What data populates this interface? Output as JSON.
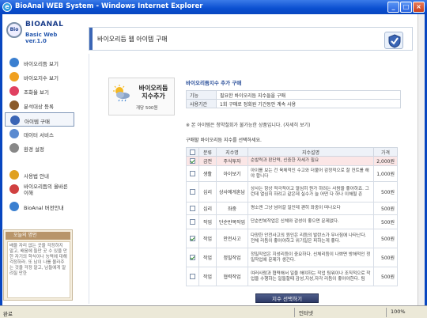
{
  "window": {
    "title": "BioAnal WEB System - Windows Internet Explorer"
  },
  "logo": {
    "line1": "BIOANAL",
    "line2": "Basic Web ver.1.0",
    "badge": "Bio"
  },
  "header": {
    "title": "바이오리듬 웹 아이템 구매"
  },
  "sidebar": {
    "items": [
      {
        "label": "바이오리듬 보기",
        "icon": "globe-icon",
        "color": "#3a7fd0"
      },
      {
        "label": "바이오지수 보기",
        "icon": "star-icon",
        "color": "#f0a020"
      },
      {
        "label": "조화율 보기",
        "icon": "heart-icon",
        "color": "#e04060"
      },
      {
        "label": "분석대상 등록",
        "icon": "pencil-icon",
        "color": "#8a5a2a"
      },
      {
        "label": "아이템 구매",
        "icon": "shield-icon",
        "color": "#3a65b5"
      },
      {
        "label": "데이터 서비스",
        "icon": "data-icon",
        "color": "#5a8ad0"
      },
      {
        "label": "환경 설정",
        "icon": "gear-icon",
        "color": "#888888"
      },
      {
        "label": "사용법 안내",
        "icon": "help-icon",
        "color": "#e0a020"
      },
      {
        "label": "바이오리듬의 올바른 이해",
        "icon": "info-icon",
        "color": "#d04040"
      },
      {
        "label": "BioAnal 버전안내",
        "icon": "monitor-icon",
        "color": "#3a7fd0"
      }
    ],
    "news_title": "오늘의 명언",
    "news_text": "배울 자리 없는 곳을 걱정하지 말고, 배움에 들만 곳 수 있을 만한 자기의 학식이나 능력에 대해 걱정하라. 또 남이 나를 몰라주는 것을 걱정 말고, 남들에게 알려질 만한"
  },
  "item_card": {
    "title_line1": "바이오리듬",
    "title_line2": "지수추가",
    "price": "개당 500원"
  },
  "section_title": "바이오리듬지수 추가 구매",
  "info": [
    {
      "key": "기능",
      "value": "필요한 바이오리듬 지수들을 구매"
    },
    {
      "key": "사용기간",
      "value": "1회 구매로 정회원 기간동안 계속 사용"
    }
  ],
  "notice": "※ 본 아이템은 청약철회가 불가능한 상품입니다. (자세히 보기)",
  "intro": "구매할 바이오리듬 지수를 선택하세요.",
  "table": {
    "headers": [
      "",
      "분류",
      "지수명",
      "지수설명",
      "가격"
    ],
    "rows": [
      {
        "checked": true,
        "cat": "금전",
        "name": "주식투자",
        "desc": "순발력과 판단력, 신중한 자세가 필요",
        "price": "2,000원",
        "highlight": true
      },
      {
        "checked": false,
        "cat": "생활",
        "name": "아이보기",
        "desc": "아이를 보는 건 육체적인 수고와 더불어 감정적으로 잘 컨트롤 해야 합니다",
        "price": "1,000원",
        "highlight": false
      },
      {
        "checked": false,
        "cat": "심리",
        "name": "상사에게혼남",
        "desc": "상사는 항상 적극적이고 열심히 뭔가 하려는 사람을 좋아하죠. 그런데 열심히 하려고 같은데 실수가 늘 어떤 다 하나 이해될 존",
        "price": "500원",
        "highlight": false
      },
      {
        "checked": false,
        "cat": "심리",
        "name": "좌중",
        "desc": "평소엔 그냥 넘어갈 일인데 괜히 좌중이 떠나오다",
        "price": "500원",
        "highlight": false
      },
      {
        "checked": false,
        "cat": "작업",
        "name": "단순반복작업",
        "desc": "단순반복작업은 신체와 감성이 좋으면 문제없다.",
        "price": "500원",
        "highlight": false
      },
      {
        "checked": true,
        "cat": "작업",
        "name": "안전사고",
        "desc": "다양한 안전사고의 원인은 리듬의 발란스가 무너짐에 나타난다. 전체 리듬이 좋아야하고 위기일은 피하는게 좋다.",
        "price": "500원",
        "highlight": false
      },
      {
        "checked": true,
        "cat": "작업",
        "name": "정밀작업",
        "desc": "정밀작업은 지성리듬이 중요하다. 신체리듬이 나쁘면 방해적인 정밀작업에 문제가 생긴다.",
        "price": "500원",
        "highlight": false
      },
      {
        "checked": false,
        "cat": "작업",
        "name": "협력작업",
        "desc": "여러사람과 협력해서 일을 해야하는 작업 팀워이나 조직적으로 작업을 수행하는 일들할때 감성,지성,자각 리듬이 좋아야한다. 팀",
        "price": "500원",
        "highlight": false
      }
    ]
  },
  "select_button": "지수 선택하기",
  "status": {
    "left": "완료",
    "zone": "인터넷",
    "zoom": "100%"
  }
}
